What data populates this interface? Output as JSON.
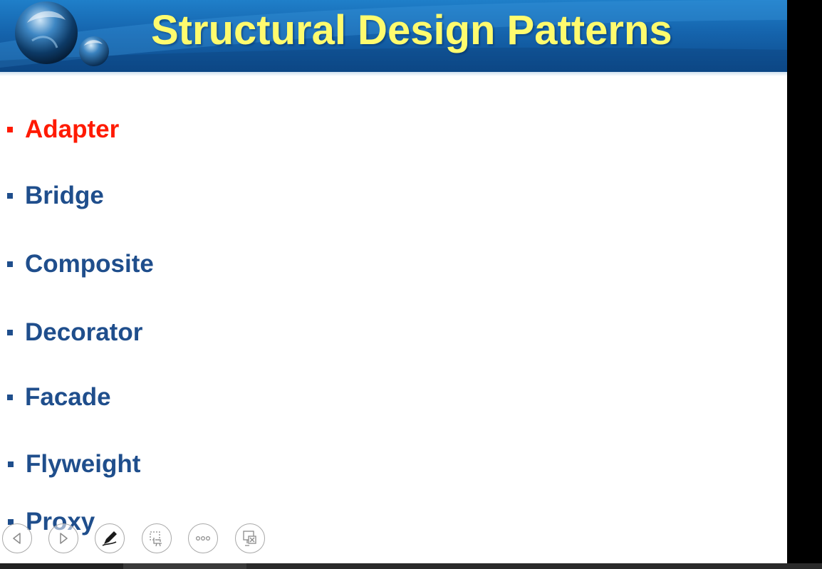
{
  "slide": {
    "title": "Structural Design Patterns",
    "bullets": [
      {
        "label": "Adapter",
        "color": "#ff1a00"
      },
      {
        "label": "Bridge",
        "color": "#1f4e8c"
      },
      {
        "label": "Composite",
        "color": "#1f4e8c"
      },
      {
        "label": "Decorator",
        "color": "#1f4e8c"
      },
      {
        "label": "Facade",
        "color": "#1f4e8c"
      },
      {
        "label": "Flyweight",
        "color": "#1f4e8c"
      },
      {
        "label": "Proxy",
        "color": "#1f4e8c"
      }
    ]
  },
  "colors": {
    "title": "#fffb6e",
    "banner": "#1564ad",
    "highlight": "#ff1a00",
    "body_text": "#1f4e8c"
  },
  "controls": [
    {
      "name": "previous-slide",
      "icon": "triangle-left-icon"
    },
    {
      "name": "next-slide",
      "icon": "triangle-right-icon"
    },
    {
      "name": "pen-tool",
      "icon": "pen-icon"
    },
    {
      "name": "see-all-slides",
      "icon": "slides-grid-icon"
    },
    {
      "name": "more-options",
      "icon": "ellipsis-icon"
    },
    {
      "name": "end-show",
      "icon": "screen-close-icon"
    }
  ]
}
